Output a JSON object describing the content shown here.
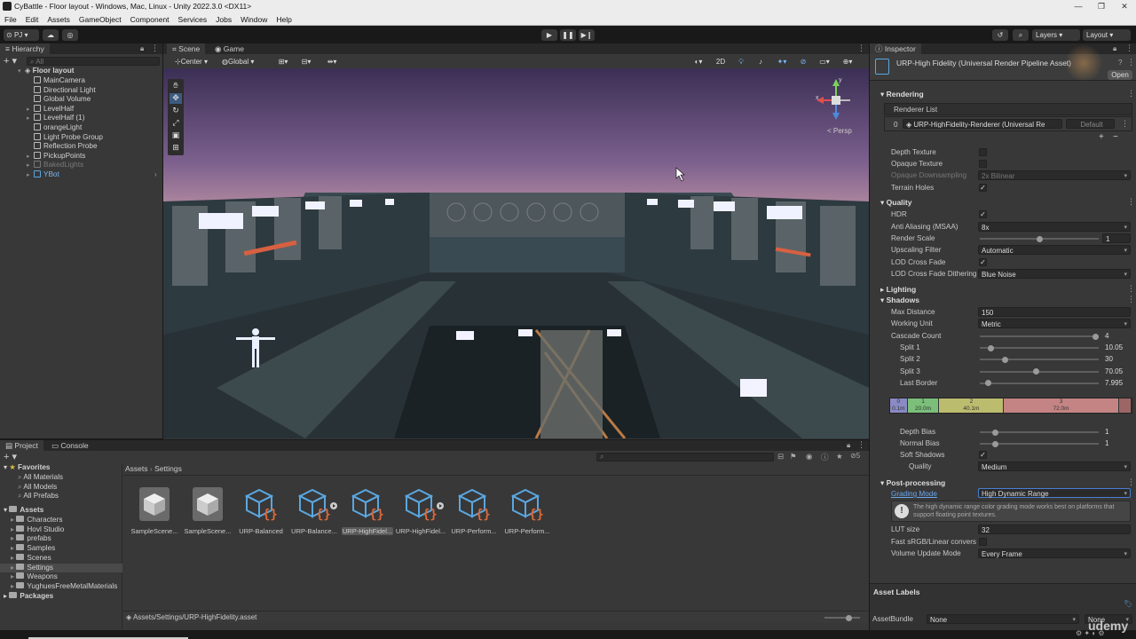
{
  "window": {
    "title": "CyBattle - Floor layout - Windows, Mac, Linux - Unity 2022.3.0 <DX11>"
  },
  "menu": [
    "File",
    "Edit",
    "Assets",
    "GameObject",
    "Component",
    "Services",
    "Jobs",
    "Window",
    "Help"
  ],
  "toolbar": {
    "account": "PJ",
    "layers": "Layers",
    "layout": "Layout"
  },
  "hierarchy": {
    "tab": "Hierarchy",
    "search_placeholder": "All",
    "scene_name": "Floor layout",
    "items": [
      {
        "label": "MainCamera",
        "expandable": false,
        "dim": false
      },
      {
        "label": "Directional Light",
        "expandable": false,
        "dim": false
      },
      {
        "label": "Global Volume",
        "expandable": false,
        "dim": false
      },
      {
        "label": "LevelHalf",
        "expandable": true,
        "dim": false
      },
      {
        "label": "LevelHalf (1)",
        "expandable": true,
        "dim": false
      },
      {
        "label": "orangeLight",
        "expandable": false,
        "dim": false
      },
      {
        "label": "Light Probe Group",
        "expandable": false,
        "dim": false
      },
      {
        "label": "Reflection Probe",
        "expandable": false,
        "dim": false
      },
      {
        "label": "PickupPoints",
        "expandable": true,
        "dim": false
      },
      {
        "label": "BakedLights",
        "expandable": true,
        "dim": true
      },
      {
        "label": "YBot",
        "expandable": true,
        "dim": false,
        "blue": true
      }
    ]
  },
  "scene_view": {
    "tabs": [
      "Scene",
      "Game"
    ],
    "pivot": "Center",
    "space": "Global",
    "mode_2d": "2D",
    "projection": "< Persp",
    "gizmo_axes": {
      "x": "x",
      "y": "y",
      "z": "z"
    }
  },
  "inspector": {
    "tab": "Inspector",
    "asset_title": "URP-High Fidelity (Universal Render Pipeline Asset)",
    "open_button": "Open",
    "rendering": {
      "header": "Rendering",
      "renderer_list_label": "Renderer List",
      "renderer_index": "0",
      "renderer_value": "URP-HighFidelity-Renderer (Universal Re",
      "default_label": "Default",
      "depth_texture": "Depth Texture",
      "opaque_texture": "Opaque Texture",
      "opaque_downsampling": "Opaque Downsampling",
      "opaque_downsampling_value": "2x Bilinear",
      "terrain_holes": "Terrain Holes"
    },
    "quality": {
      "header": "Quality",
      "hdr": "HDR",
      "msaa_label": "Anti Aliasing (MSAA)",
      "msaa_value": "8x",
      "render_scale_label": "Render Scale",
      "render_scale_value": "1",
      "render_scale_fraction": 0.5,
      "upscaling_label": "Upscaling Filter",
      "upscaling_value": "Automatic",
      "lod_crossfade": "LOD Cross Fade",
      "lod_dither_label": "LOD Cross Fade Dithering",
      "lod_dither_value": "Blue Noise"
    },
    "lighting_header": "Lighting",
    "shadows": {
      "header": "Shadows",
      "max_distance_label": "Max Distance",
      "max_distance_value": "150",
      "working_unit_label": "Working Unit",
      "working_unit_value": "Metric",
      "cascade_label": "Cascade Count",
      "cascade_value": "4",
      "cascade_fraction": 1.0,
      "splits": [
        {
          "label": "Split 1",
          "value": "10.05",
          "fraction": 0.07
        },
        {
          "label": "Split 2",
          "value": "30",
          "fraction": 0.2
        },
        {
          "label": "Split 3",
          "value": "70.05",
          "fraction": 0.47
        },
        {
          "label": "Last Border",
          "value": "7.995",
          "fraction": 0.05
        }
      ],
      "cascade_bar": [
        {
          "index": "0",
          "dist": "0.1m",
          "color": "#8a8ac4",
          "fraction": 0.07
        },
        {
          "index": "1",
          "dist": "20.0m",
          "color": "#7bbf7b",
          "fraction": 0.13
        },
        {
          "index": "2",
          "dist": "40.1m",
          "color": "#bcbc6e",
          "fraction": 0.27
        },
        {
          "index": "3",
          "dist": "72.0m",
          "color": "#c48484",
          "fraction": 0.48
        },
        {
          "index": "",
          "dist": "",
          "color": "#9c6666",
          "fraction": 0.05
        }
      ],
      "depth_bias_label": "Depth Bias",
      "depth_bias_value": "1",
      "normal_bias_label": "Normal Bias",
      "normal_bias_value": "1",
      "soft_shadows": "Soft Shadows",
      "quality_label": "Quality",
      "quality_value": "Medium"
    },
    "post": {
      "header": "Post-processing",
      "grading_label": "Grading Mode",
      "grading_value": "High Dynamic Range",
      "info": "The high dynamic range color grading mode works best on platforms that support floating point textures.",
      "lut_label": "LUT size",
      "lut_value": "32",
      "fast_srgb": "Fast sRGB/Linear convers",
      "volume_label": "Volume Update Mode",
      "volume_value": "Every Frame"
    },
    "asset_labels": "Asset Labels",
    "assetbundle_label": "AssetBundle",
    "assetbundle_value": "None",
    "assetbundle_variant": "None"
  },
  "project": {
    "tabs": [
      "Project",
      "Console"
    ],
    "favorites_label": "Favorites",
    "favorites": [
      "All Materials",
      "All Models",
      "All Prefabs"
    ],
    "assets_label": "Assets",
    "folders": [
      "Characters",
      "Hovl Studio",
      "prefabs",
      "Samples",
      "Scenes",
      "Settings",
      "Weapons",
      "YughuesFreeMetalMaterials"
    ],
    "packages_label": "Packages",
    "breadcrumb_root": "Assets",
    "breadcrumb_current": "Settings",
    "hidden_count": "5",
    "items": [
      {
        "label": "SampleScene...",
        "kind": "cube"
      },
      {
        "label": "SampleScene...",
        "kind": "cube"
      },
      {
        "label": "URP-Balanced",
        "kind": "urp",
        "play": false
      },
      {
        "label": "URP-Balance...",
        "kind": "urp",
        "play": true
      },
      {
        "label": "URP-HighFidel...",
        "kind": "urp",
        "play": false,
        "selected": true
      },
      {
        "label": "URP-HighFidel...",
        "kind": "urp",
        "play": true
      },
      {
        "label": "URP-Perform...",
        "kind": "urp",
        "play": false
      },
      {
        "label": "URP-Perform...",
        "kind": "urp",
        "play": false
      }
    ],
    "status_path": "Assets/Settings/URP-HighFidelity.asset"
  },
  "watermark": "udemy"
}
